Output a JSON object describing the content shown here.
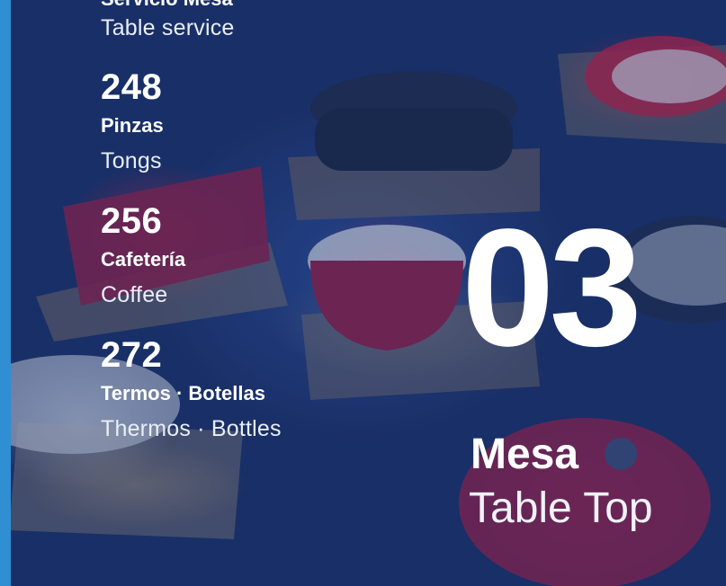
{
  "top": {
    "cut_title": "Servicio Mesa",
    "subtitle": "Table service"
  },
  "items": [
    {
      "number": "248",
      "name_es": "Pinzas",
      "name_en": "Tongs"
    },
    {
      "number": "256",
      "name_es": "Cafetería",
      "name_en": "Coffee"
    },
    {
      "number": "272",
      "name_es": "Termos · Botellas",
      "name_en": "Thermos · Bottles"
    }
  ],
  "section": {
    "number": "03",
    "title": "Mesa",
    "subtitle": "Table Top"
  },
  "colors": {
    "accent_stripe": "#2f8fd2",
    "text": "#ffffff",
    "background": "#1b2f63"
  }
}
